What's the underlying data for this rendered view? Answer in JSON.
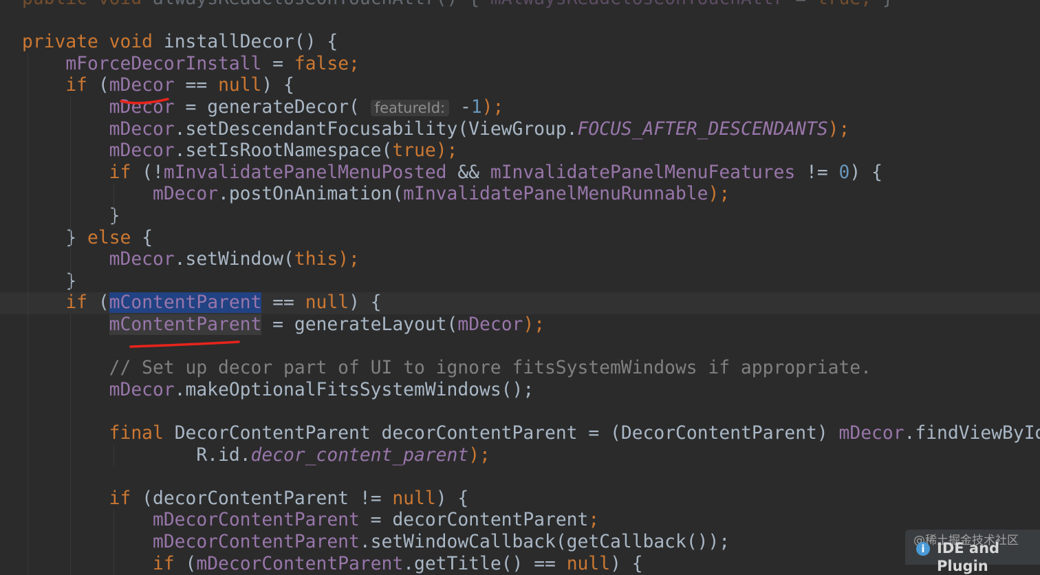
{
  "editor": {
    "language": "Java",
    "colors": {
      "background": "#2b2b2b",
      "text": "#a9b7c6",
      "keyword": "#cc7832",
      "number": "#6897bb",
      "field": "#9876aa",
      "comment": "#808080",
      "selection": "#214283",
      "annotation_stroke": "#e8241c"
    },
    "lines": [
      {
        "text": "public void alwaysReadCloseOnTouchAttr() { mAlwaysReadCloseOnTouchAttr = true; }"
      },
      {
        "text": ""
      },
      {
        "text": "private void installDecor() {"
      },
      {
        "text": "    mForceDecorInstall = false;"
      },
      {
        "text": "    if (mDecor == null) {"
      },
      {
        "text": "        mDecor = generateDecor( featureId: -1);",
        "hint": "featureId:"
      },
      {
        "text": "        mDecor.setDescendantFocusability(ViewGroup.FOCUS_AFTER_DESCENDANTS);"
      },
      {
        "text": "        mDecor.setIsRootNamespace(true);"
      },
      {
        "text": "        if (!mInvalidatePanelMenuPosted && mInvalidatePanelMenuFeatures != 0) {"
      },
      {
        "text": "            mDecor.postOnAnimation(mInvalidatePanelMenuRunnable);"
      },
      {
        "text": "        }"
      },
      {
        "text": "    } else {"
      },
      {
        "text": "        mDecor.setWindow(this);"
      },
      {
        "text": "    }"
      },
      {
        "text": "    if (mContentParent == null) {",
        "selected": "mContentParent"
      },
      {
        "text": "        mContentParent = generateLayout(mDecor);"
      },
      {
        "text": ""
      },
      {
        "text": "        // Set up decor part of UI to ignore fitsSystemWindows if appropriate."
      },
      {
        "text": "        mDecor.makeOptionalFitsSystemWindows();"
      },
      {
        "text": ""
      },
      {
        "text": "        final DecorContentParent decorContentParent = (DecorContentParent) mDecor.findViewById("
      },
      {
        "text": "                R.id.decor_content_parent);"
      },
      {
        "text": ""
      },
      {
        "text": "        if (decorContentParent != null) {"
      },
      {
        "text": "            mDecorContentParent = decorContentParent;"
      },
      {
        "text": "            mDecorContentParent.setWindowCallback(getCallback());"
      },
      {
        "text": "            if (mDecorContentParent.getTitle() == null) {"
      }
    ]
  },
  "badge": {
    "icon": "info-icon",
    "icon_glyph": "i",
    "label": "IDE and Plugin",
    "watermark": "@稀土掘金技术社区"
  }
}
